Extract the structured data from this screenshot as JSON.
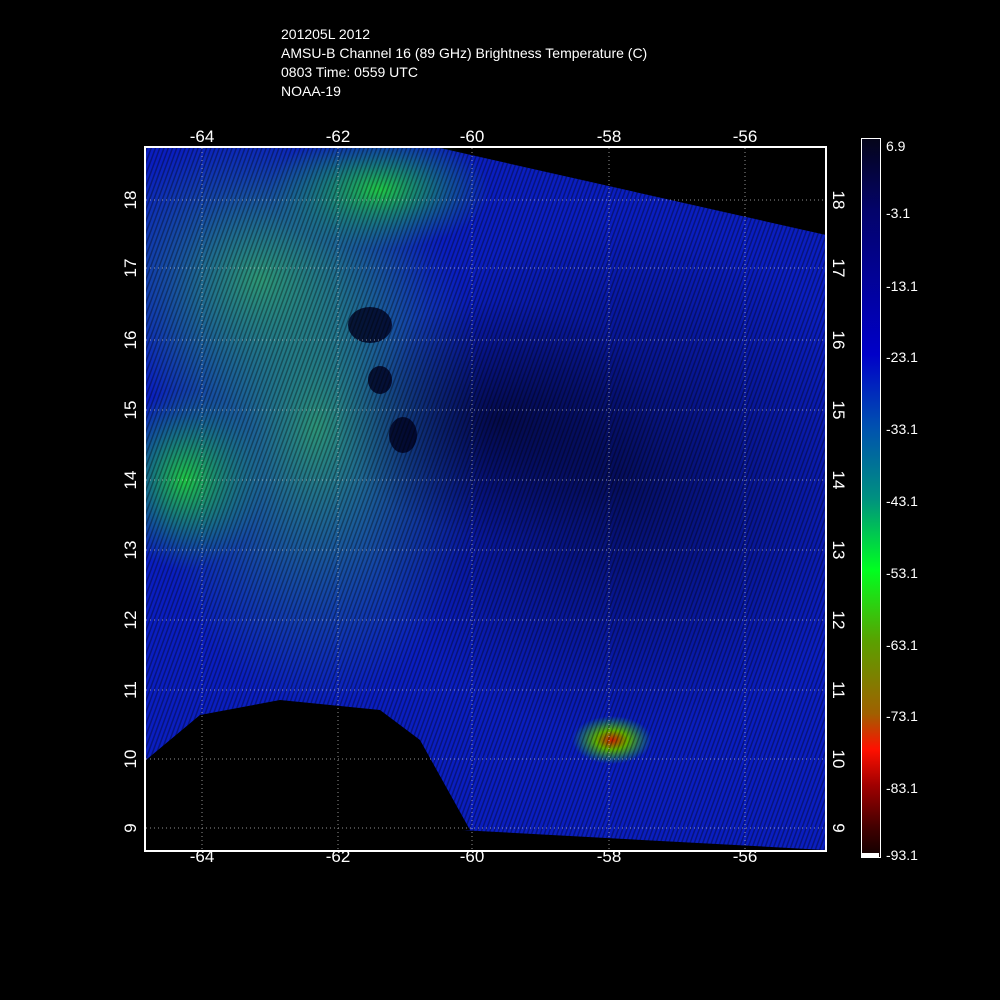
{
  "header": {
    "storm": "201205L 2012",
    "product": "AMSU-B Channel 16 (89 GHz) Brightness Temperature (C)",
    "time": "0803 Time: 0559 UTC",
    "satellite": "NOAA-19"
  },
  "map": {
    "lon_ticks": [
      "-64",
      "-62",
      "-60",
      "-58",
      "-56"
    ],
    "lat_ticks": [
      "18",
      "17",
      "16",
      "15",
      "14",
      "13",
      "12",
      "11",
      "10",
      "9"
    ],
    "lon_range": [
      -64.8,
      -54.8
    ],
    "lat_range": [
      8.7,
      18.8
    ]
  },
  "colorbar": {
    "labels": [
      "6.9",
      "-3.1",
      "-13.1",
      "-23.1",
      "-33.1",
      "-43.1",
      "-53.1",
      "-63.1",
      "-73.1",
      "-83.1",
      "-93.1"
    ],
    "colors": [
      "#05051a",
      "#0000c8",
      "#009080",
      "#00ff20",
      "#ff1000",
      "#100000"
    ]
  }
}
